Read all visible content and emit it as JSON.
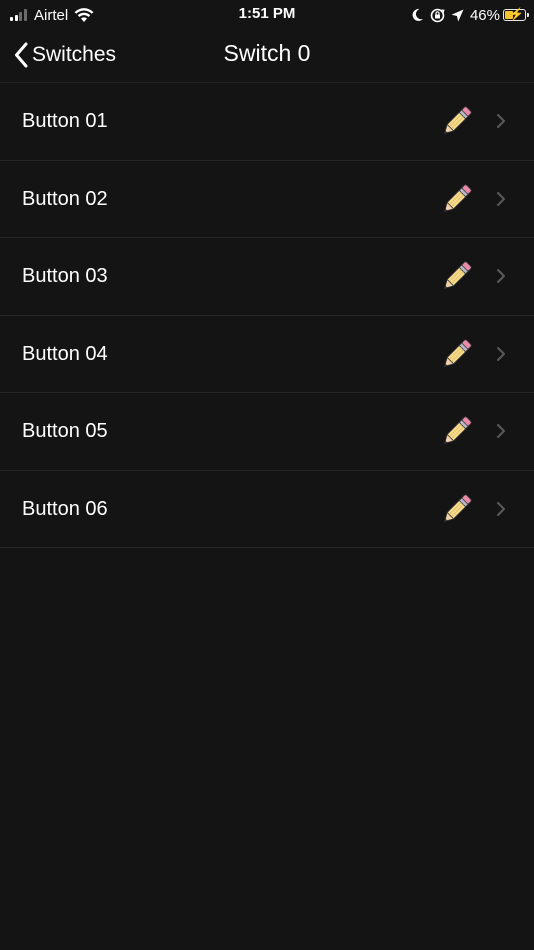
{
  "status_bar": {
    "carrier": "Airtel",
    "time": "1:51 PM",
    "battery_percent": "46%",
    "battery_level": 0.46,
    "battery_charging": true,
    "icons": [
      "signal-icon",
      "wifi-icon",
      "moon-icon",
      "orientation-lock-icon",
      "location-arrow-icon",
      "battery-icon"
    ],
    "battery_fill_color": "#f4c430"
  },
  "nav": {
    "back_label": "Switches",
    "title": "Switch 0"
  },
  "list": {
    "items": [
      {
        "label": "Button 01"
      },
      {
        "label": "Button 02"
      },
      {
        "label": "Button 03"
      },
      {
        "label": "Button 04"
      },
      {
        "label": "Button 05"
      },
      {
        "label": "Button 06"
      }
    ],
    "row_icon": "pencil-icon",
    "row_accessory": "chevron-right-icon"
  },
  "colors": {
    "background": "#141414",
    "separator": "#262626",
    "text": "#ffffff",
    "chevron": "#5a5a5a"
  }
}
